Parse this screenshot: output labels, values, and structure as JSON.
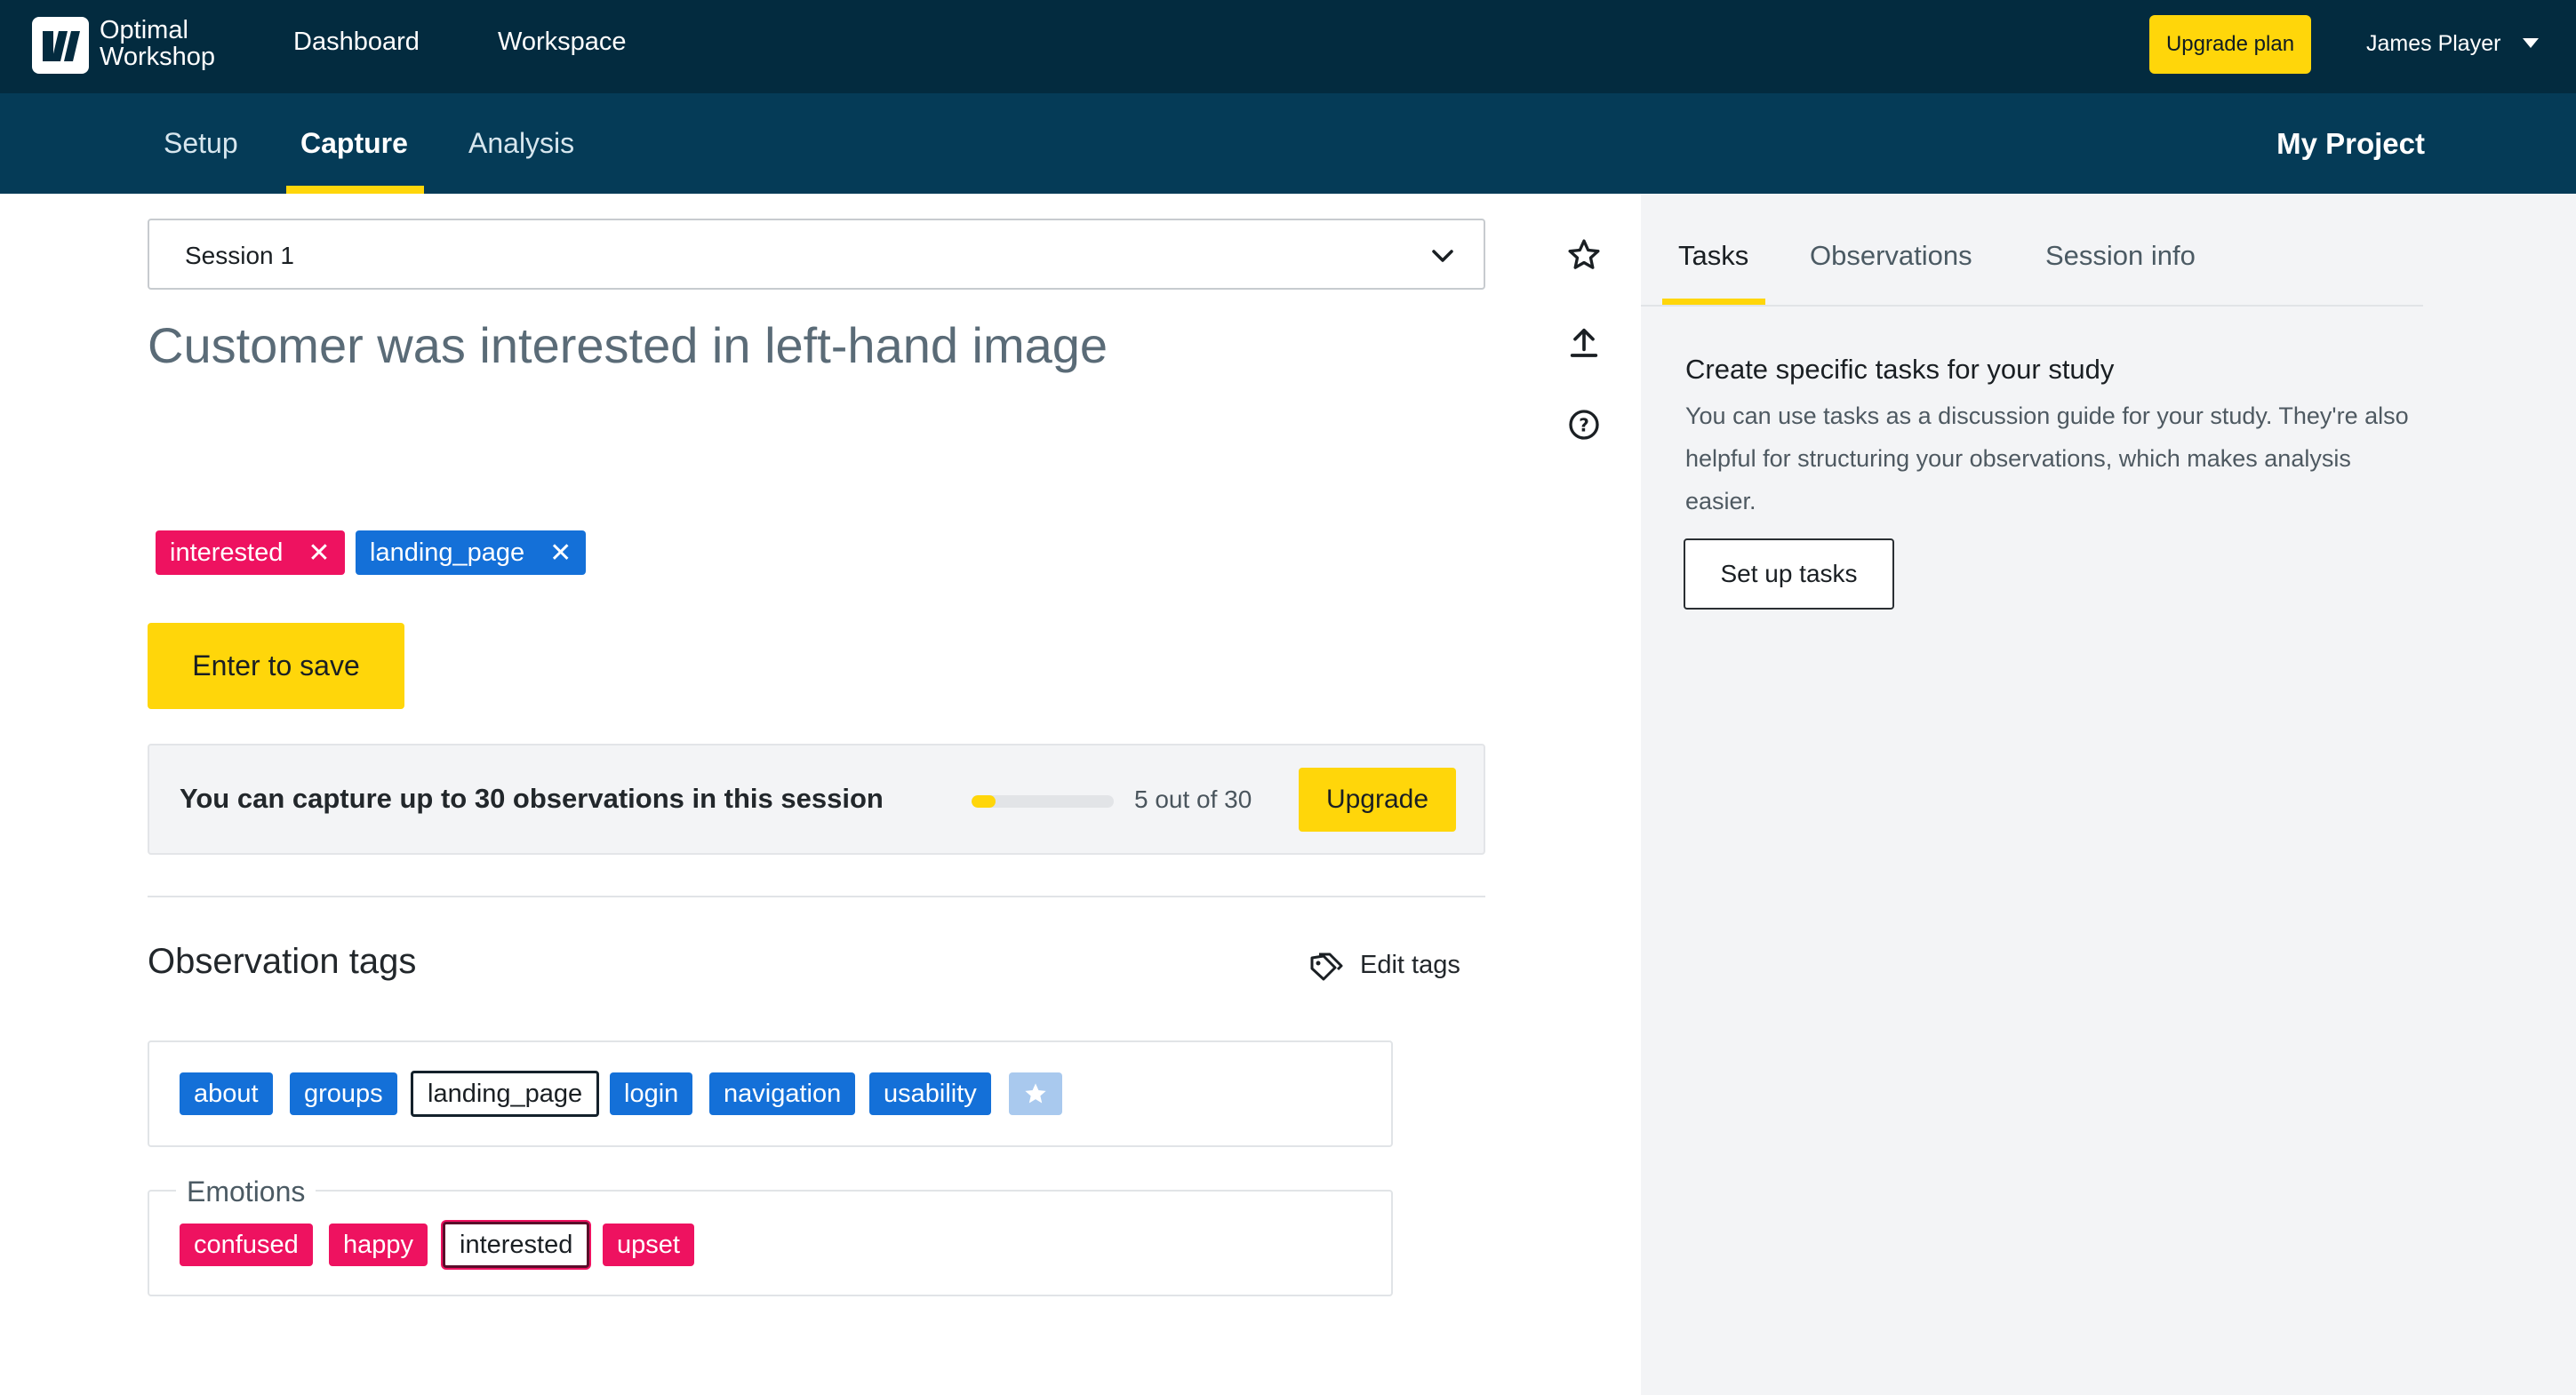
{
  "app": {
    "brand_line1": "Optimal",
    "brand_line2": "Workshop",
    "nav": [
      "Dashboard",
      "Workspace"
    ],
    "upgrade_plan": "Upgrade plan",
    "user_name": "James Player",
    "icons": {
      "logo": "optimal-workshop-logo",
      "user_menu": "caret-down-icon"
    }
  },
  "subnav": {
    "tabs": [
      "Setup",
      "Capture",
      "Analysis"
    ],
    "active_tab": "Capture",
    "project": "My Project"
  },
  "capture": {
    "session": "Session 1",
    "observation_text": "Customer was interested in left-hand image",
    "applied_tags": [
      {
        "label": "interested",
        "color": "#ee1260"
      },
      {
        "label": "landing_page",
        "color": "#1470d8"
      }
    ],
    "save_label": "Enter to save",
    "limit": {
      "text": "You can capture up to 30 observations in this session",
      "used": 5,
      "total": 30,
      "count_text": "5 out of 30",
      "upgrade_label": "Upgrade"
    }
  },
  "observation_tags": {
    "heading": "Observation tags",
    "edit_label": "Edit tags",
    "general": [
      "about",
      "groups",
      "landing_page",
      "login",
      "navigation",
      "usability"
    ],
    "general_selected": "landing_page",
    "emotions": {
      "title": "Emotions",
      "tags": [
        "confused",
        "happy",
        "interested",
        "upset"
      ],
      "selected": "interested"
    },
    "colors": {
      "general": "#1470d8",
      "emotions": "#ee1260"
    }
  },
  "side_icons": [
    "star-icon",
    "upload-icon",
    "help-icon"
  ],
  "right_panel": {
    "tabs": [
      "Tasks",
      "Observations",
      "Session info"
    ],
    "active_tab": "Tasks",
    "title": "Create specific tasks for your study",
    "description": "You can use tasks as a discussion guide for your study. They're also helpful for structuring your observations, which makes analysis easier.",
    "button": "Set up tasks"
  }
}
